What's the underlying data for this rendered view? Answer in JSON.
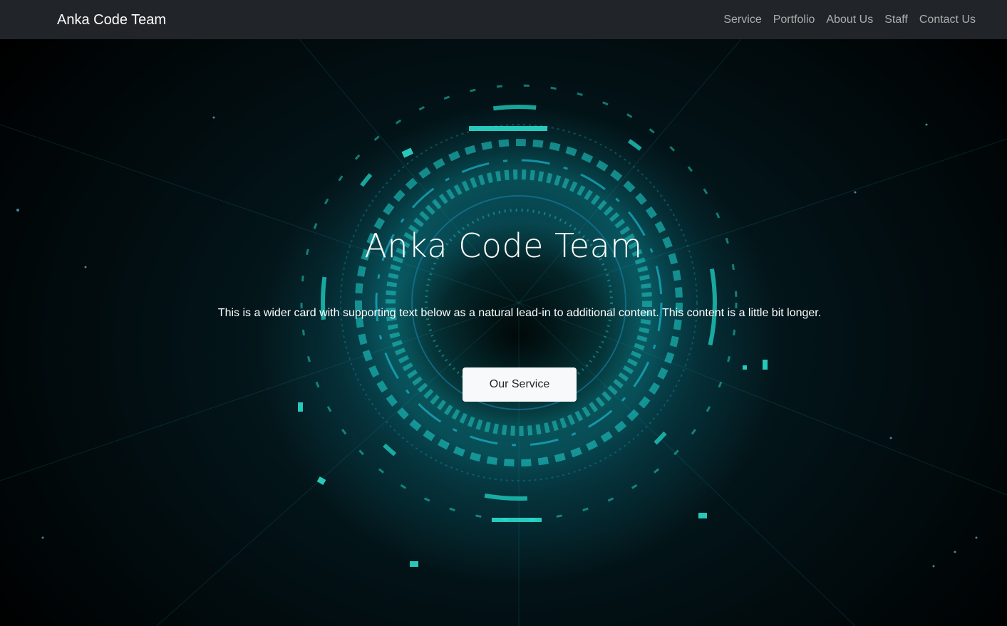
{
  "navbar": {
    "brand": "Anka Code Team",
    "links": [
      "Service",
      "Portfolio",
      "About Us",
      "Staff",
      "Contact Us"
    ]
  },
  "hero": {
    "title": "Anka Code Team",
    "text": "This is a wider card with supporting text below as a natural lead-in to additional content. This content is a little bit longer.",
    "button_label": "Our Service"
  },
  "colors": {
    "navbar_bg": "#212529",
    "accent": "#22e0d0",
    "button_bg": "#f8f9fa",
    "button_text": "#212529"
  }
}
